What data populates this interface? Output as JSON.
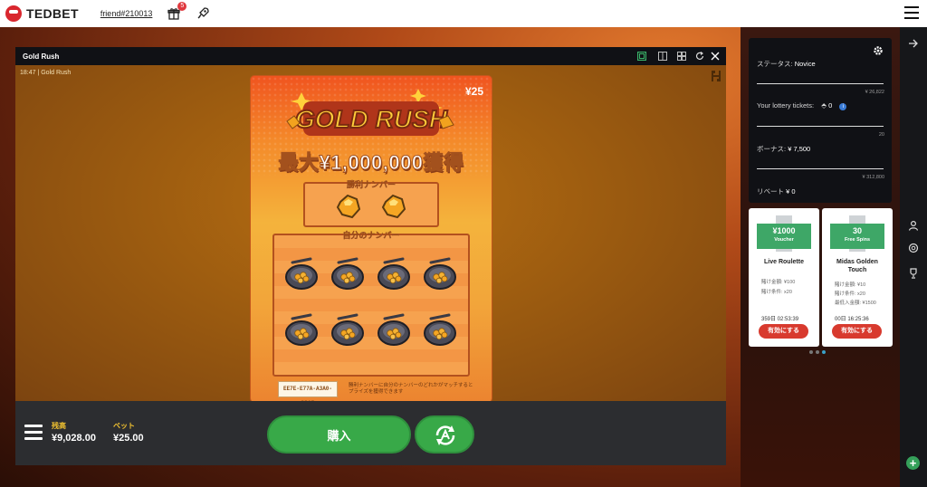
{
  "header": {
    "brand": "TEDBET",
    "friend_link": "friend#210013",
    "gift_badge": "5"
  },
  "game_window": {
    "title": "Gold Rush",
    "clock_label": "18:47 | Gold Rush",
    "card": {
      "price": "¥25",
      "title": "GOLD RUSH",
      "max_win": "最大¥1,000,000獲得",
      "winning_label": "勝利ナンバー",
      "my_label": "自分のナンバー",
      "ticket_id": "EE7E-E77A-A3A0-DB27",
      "rules": "勝利ナンバーに自分のナンバーのどれかがマッチするとプライズを獲得できます"
    },
    "bottom": {
      "balance_label": "残高",
      "balance_value": "¥9,028.00",
      "bet_label": "ベット",
      "bet_value": "¥25.00",
      "buy_label": "購入"
    }
  },
  "stats_panel": {
    "status_label": "ステータス:",
    "status_value": "Novice",
    "status_max": "¥ 26,822",
    "tickets_label": "Your lottery tickets:",
    "tickets_value": "0",
    "tickets_max": "20",
    "bonus_label": "ボーナス:",
    "bonus_value": "¥ 7,500",
    "bonus_max": "¥ 312,800",
    "rebate_label": "リベート",
    "rebate_value": "¥ 0"
  },
  "bonus_cards": [
    {
      "amount": "¥1000",
      "type": "Voucher",
      "name": "Live Roulette",
      "line1": "賭け金額: ¥100",
      "line2": "賭け条件: x20",
      "line3": "",
      "timer": "359日  02:53:39",
      "button": "有効にする"
    },
    {
      "amount": "30",
      "type": "Free Spins",
      "name": "Midas Golden Touch",
      "line1": "賭け金額: ¥10",
      "line2": "賭け条件: x20",
      "line3": "最低入金額: ¥1500",
      "timer": "00日  16:25:36",
      "button": "有効にする"
    }
  ],
  "colors": {
    "accent_green": "#38a948",
    "brand_red": "#d9272e",
    "button_red": "#d83a2e",
    "gold_label": "#f2c230"
  }
}
